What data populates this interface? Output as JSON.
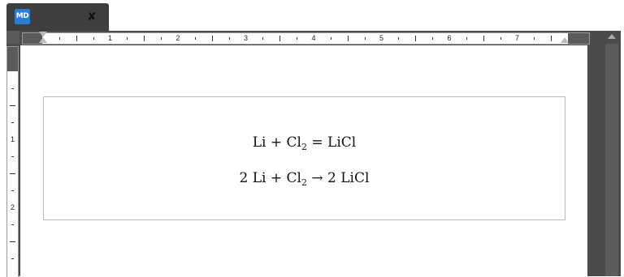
{
  "tab": {
    "app_icon_label": "MD",
    "pin_icon": "pin-icon"
  },
  "ruler": {
    "horizontal_numbers": [
      "1",
      "2",
      "3",
      "4",
      "5",
      "6",
      "7"
    ],
    "vertical_numbers": [
      "1",
      "2"
    ]
  },
  "equations": {
    "eq1": {
      "left": "Li + Cl",
      "sub": "2",
      "right": " = LiCl"
    },
    "eq2": {
      "left": "2 Li + Cl",
      "sub": "2",
      "right": " → 2 LiCl"
    }
  },
  "colors": {
    "frame": "#4b4b4b",
    "icon_blue": "#2b7cd3",
    "box_border": "#b8b8b8"
  }
}
